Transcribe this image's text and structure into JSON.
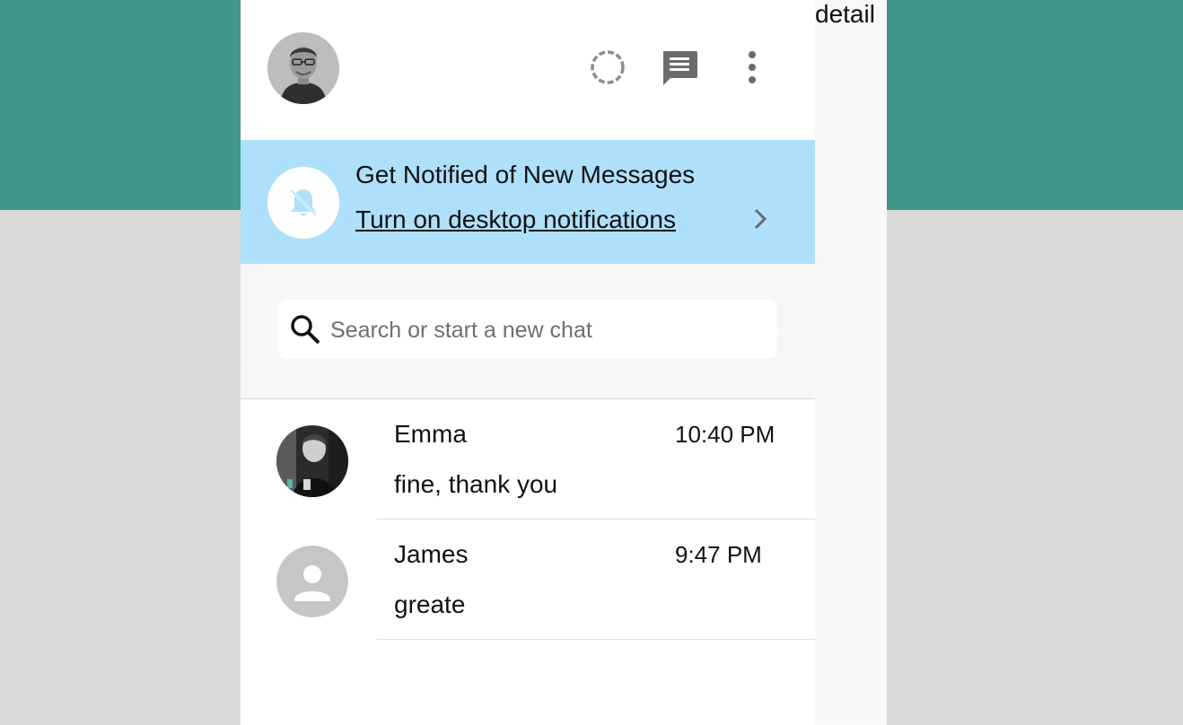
{
  "detail_panel": {
    "label": "detail"
  },
  "header": {
    "avatar_icon": "user-photo-avatar",
    "status_icon": "status-ring-icon",
    "new_chat_icon": "chat-icon",
    "menu_icon": "kebab-menu-icon"
  },
  "notification_banner": {
    "title": "Get Notified of New Messages",
    "link": "Turn on desktop notifications",
    "icon": "bell-off-icon",
    "chevron_icon": "chevron-right-icon"
  },
  "search": {
    "placeholder": "Search or start a new chat",
    "value": "",
    "icon": "search-icon"
  },
  "chats": [
    {
      "name": "Emma",
      "time": "10:40 PM",
      "last_message": "fine, thank you",
      "avatar": "photo"
    },
    {
      "name": "James",
      "time": "9:47 PM",
      "last_message": "greate",
      "avatar": "default-person-icon"
    }
  ],
  "colors": {
    "top_band": "#41968a",
    "page_bg": "#dadbd9",
    "banner_bg": "#aee0fb",
    "icon_gray": "#6b6b6b"
  }
}
